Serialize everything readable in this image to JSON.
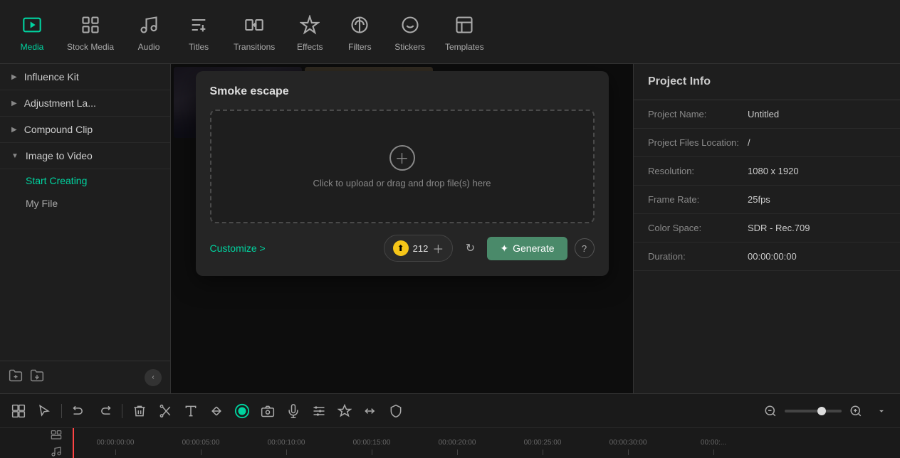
{
  "toolbar": {
    "items": [
      {
        "id": "media",
        "label": "Media",
        "icon": "media",
        "active": true
      },
      {
        "id": "stock-media",
        "label": "Stock Media",
        "icon": "stock"
      },
      {
        "id": "audio",
        "label": "Audio",
        "icon": "audio"
      },
      {
        "id": "titles",
        "label": "Titles",
        "icon": "titles"
      },
      {
        "id": "transitions",
        "label": "Transitions",
        "icon": "transitions"
      },
      {
        "id": "effects",
        "label": "Effects",
        "icon": "effects"
      },
      {
        "id": "filters",
        "label": "Filters",
        "icon": "filters"
      },
      {
        "id": "stickers",
        "label": "Stickers",
        "icon": "stickers"
      },
      {
        "id": "templates",
        "label": "Templates",
        "icon": "templates"
      }
    ]
  },
  "sidebar": {
    "items": [
      {
        "id": "influence-kit",
        "label": "Influence Kit",
        "expanded": false
      },
      {
        "id": "adjustment-la",
        "label": "Adjustment La...",
        "expanded": false
      },
      {
        "id": "compound-clip",
        "label": "Compound Clip",
        "expanded": false
      },
      {
        "id": "image-to-video",
        "label": "Image to Video",
        "expanded": true
      }
    ],
    "sub_items": [
      {
        "id": "start-creating",
        "label": "Start Creating",
        "active": true
      },
      {
        "id": "my-file",
        "label": "My File",
        "active": false
      }
    ]
  },
  "modal": {
    "title": "Smoke escape",
    "upload_text": "Click to upload or drag and drop file(s) here",
    "customize_label": "Customize >",
    "credits_count": "212",
    "generate_label": "Generate",
    "help_tooltip": "?"
  },
  "project_info": {
    "title": "Project Info",
    "rows": [
      {
        "label": "Project Name:",
        "value": "Untitled"
      },
      {
        "label": "Project Files Location:",
        "value": "/"
      },
      {
        "label": "Resolution:",
        "value": "1080 x 1920"
      },
      {
        "label": "Frame Rate:",
        "value": "25fps"
      },
      {
        "label": "Color Space:",
        "value": "SDR - Rec.709"
      },
      {
        "label": "Duration:",
        "value": "00:00:00:00"
      }
    ]
  },
  "timeline": {
    "marks": [
      "00:00:00:00",
      "00:00:05:00",
      "00:00:10:00",
      "00:00:15:00",
      "00:00:20:00",
      "00:00:25:00",
      "00:00:30:00",
      "00:00:..."
    ]
  }
}
